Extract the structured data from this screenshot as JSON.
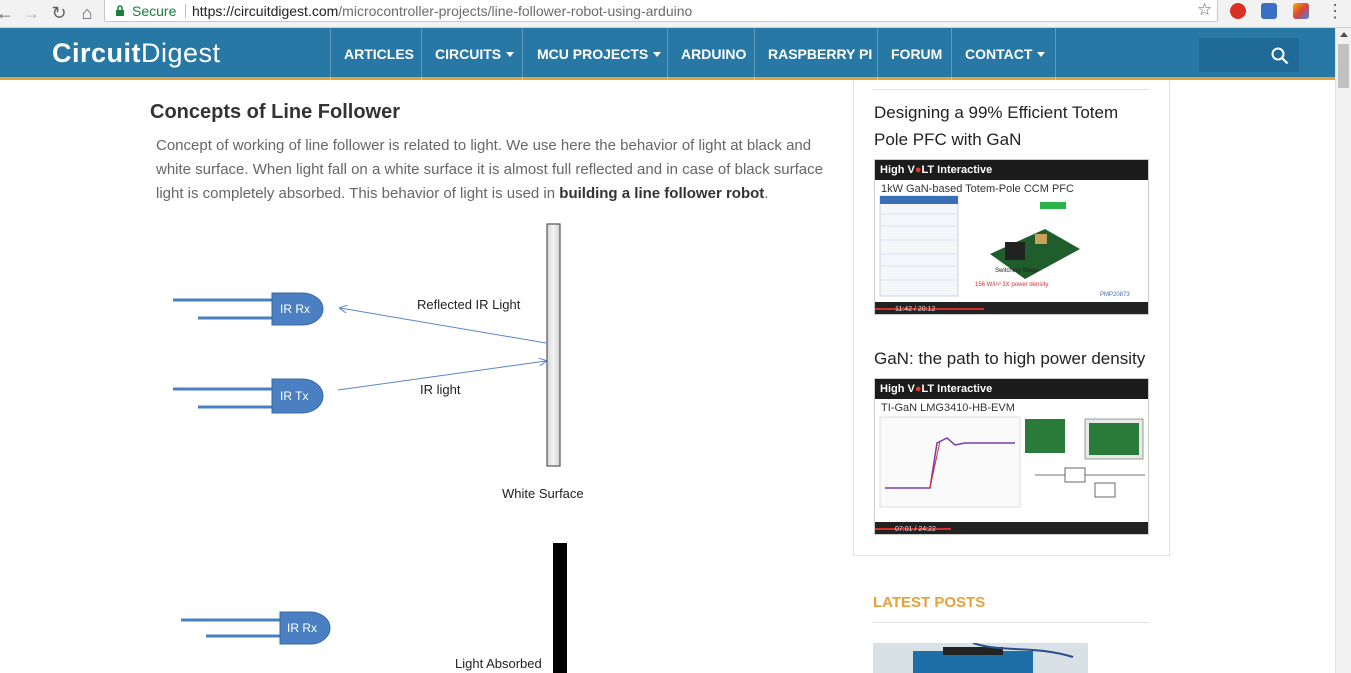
{
  "browser": {
    "secure_label": "Secure",
    "url_host": "https://circuitdigest.com",
    "url_path": "/microcontroller-projects/line-follower-robot-using-arduino"
  },
  "site": {
    "logo_circuit": "Circuit",
    "logo_digest": "Digest",
    "nav": {
      "articles": "ARTICLES",
      "circuits": "CIRCUITS",
      "mcu_projects": "MCU PROJECTS",
      "arduino": "ARDUINO",
      "raspberry_pi": "RASPBERRY PI",
      "forum": "FORUM",
      "contact": "CONTACT"
    },
    "search_placeholder": ""
  },
  "article": {
    "title": "Concepts of Line Follower",
    "para_before": "Concept of working of line follower is related to light. We use here the behavior of light at black and white surface. When light fall on a white surface it is almost full reflected and in case of black surface light is completely absorbed. This behavior of light is used in ",
    "para_bold": "building a line follower robot",
    "para_after": "."
  },
  "diagram": {
    "ir_rx": "IR Rx",
    "ir_tx": "IR Tx",
    "reflected": "Reflected IR Light",
    "ir_light": "IR light",
    "white_surface": "White Surface",
    "ir_rx_2": "IR Rx",
    "absorbed": "Light Absorbed"
  },
  "sidebar": {
    "video1": {
      "title": "Designing a 99% Efficient Totem Pole PFC with GaN",
      "bar_a": "High V",
      "bar_b": "LT Interactive",
      "subtitle": "1kW GaN-based Totem-Pole CCM PFC",
      "time": "11:42 / 20:12"
    },
    "video2": {
      "title": "GaN: the path to high power density",
      "bar_a": "High V",
      "bar_b": "LT Interactive",
      "subtitle": "TI-GaN LMG3410-HB-EVM",
      "time": "07:01 / 24:22"
    },
    "latest_posts": "LATEST POSTS"
  },
  "colors": {
    "header_bg": "#2878a6",
    "accent": "#e8a13a",
    "sensor_blue": "#4a7fc1"
  }
}
